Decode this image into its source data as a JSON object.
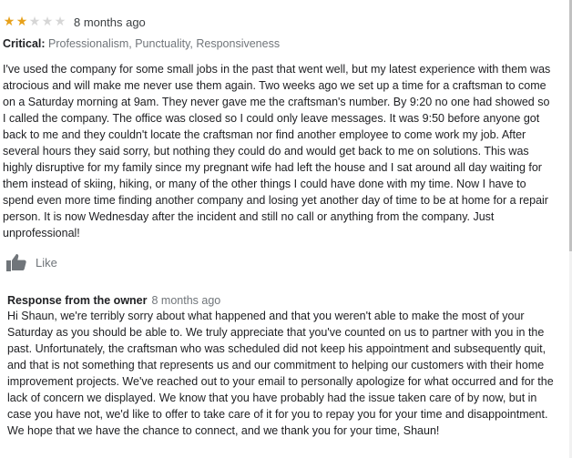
{
  "review": {
    "rating": 2,
    "max_rating": 5,
    "time": "8 months ago",
    "critical_label": "Critical:",
    "critical_values": "Professionalism, Punctuality, Responsiveness",
    "body": "I've used the company for some small jobs in the past that went well, but my latest experience with them was atrocious and will make me never use them again. Two weeks ago we set up a time for a craftsman to come on a Saturday morning at 9am. They never gave me the craftsman's number. By 9:20 no one had showed so I called the company. The office was closed so I could only leave messages. It was 9:50 before anyone got back to me and they couldn't locate the craftsman nor find another employee to come work my job. After several hours they said sorry, but nothing they could do and would get back to me on solutions. This was highly disruptive for my family since my pregnant wife had left the house and I sat around all day waiting for them instead of skiing, hiking, or many of the other things I could have done with my time. Now I have to spend even more time finding another company and losing yet another day of time to be at home for a repair person. It is now Wednesday after the incident and still no call or anything from the company. Just unprofessional!",
    "like_label": "Like",
    "like_icon": "thumbs-up-icon"
  },
  "response": {
    "title": "Response from the owner",
    "time": "8 months ago",
    "body": "Hi Shaun, we're terribly sorry about what happened and that you weren't able to make the most of your Saturday as you should be able to. We truly appreciate that you've counted on us to partner with you in the past. Unfortunately, the craftsman who was scheduled did not keep his appointment and subsequently quit, and that is not something that represents us and our commitment to helping our customers with their home improvement projects. We've reached out to your email to personally apologize for what occurred and for the lack of concern we displayed. We know that you have probably had the issue taken care of by now, but in case you have not, we'd like to offer to take care of it for you to repay you for your time and disappointment. We hope that we have the chance to connect, and we thank you for your time, Shaun!"
  },
  "colors": {
    "star_filled": "#e7a11b",
    "star_empty": "#d6d6d6",
    "text_primary": "#202124",
    "text_secondary": "#70757a"
  }
}
